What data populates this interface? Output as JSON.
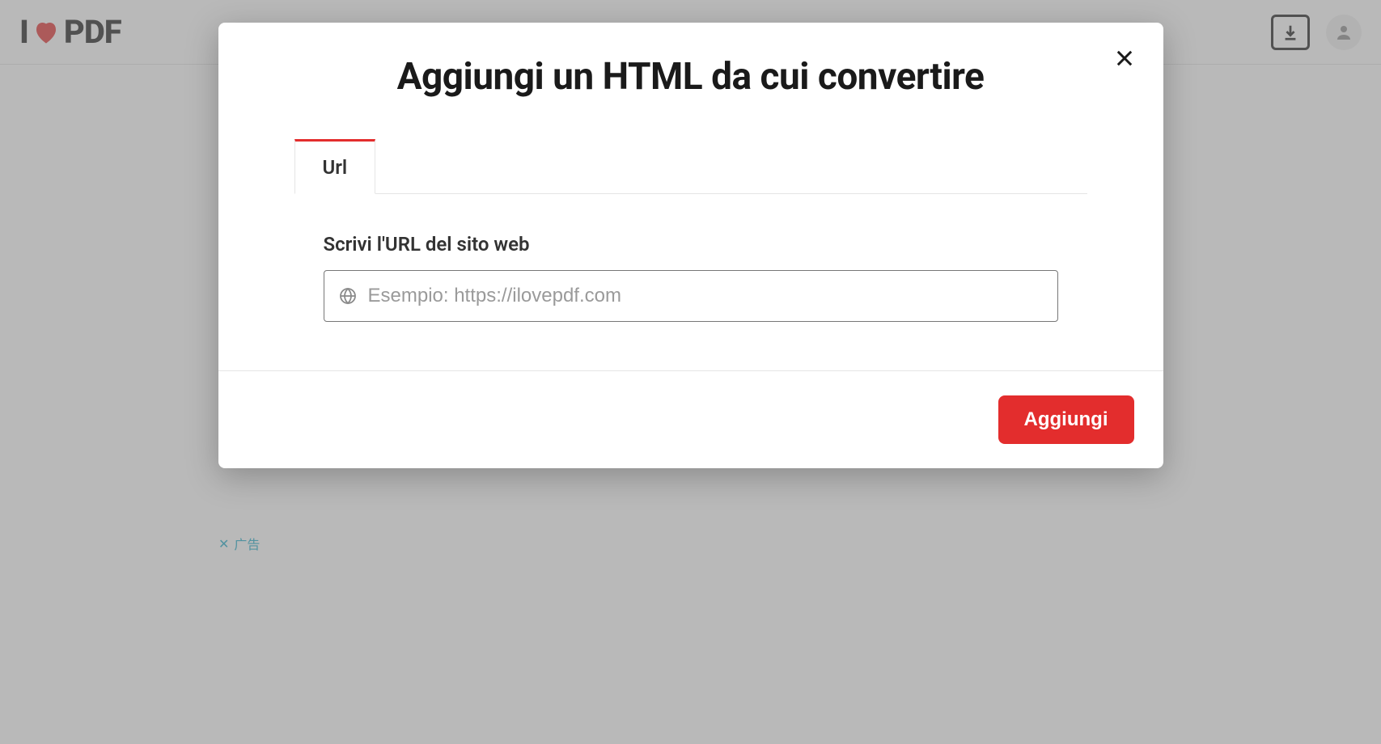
{
  "header": {
    "logo_parts": {
      "i": "I",
      "pdf": "PDF"
    }
  },
  "modal": {
    "title": "Aggiungi un HTML da cui convertire",
    "tabs": [
      {
        "label": "Url"
      }
    ],
    "field_label": "Scrivi l'URL del sito web",
    "url_placeholder": "Esempio: https://ilovepdf.com",
    "url_value": "",
    "submit_label": "Aggiungi"
  },
  "ad": {
    "close_symbol": "✕",
    "label": "广告"
  }
}
